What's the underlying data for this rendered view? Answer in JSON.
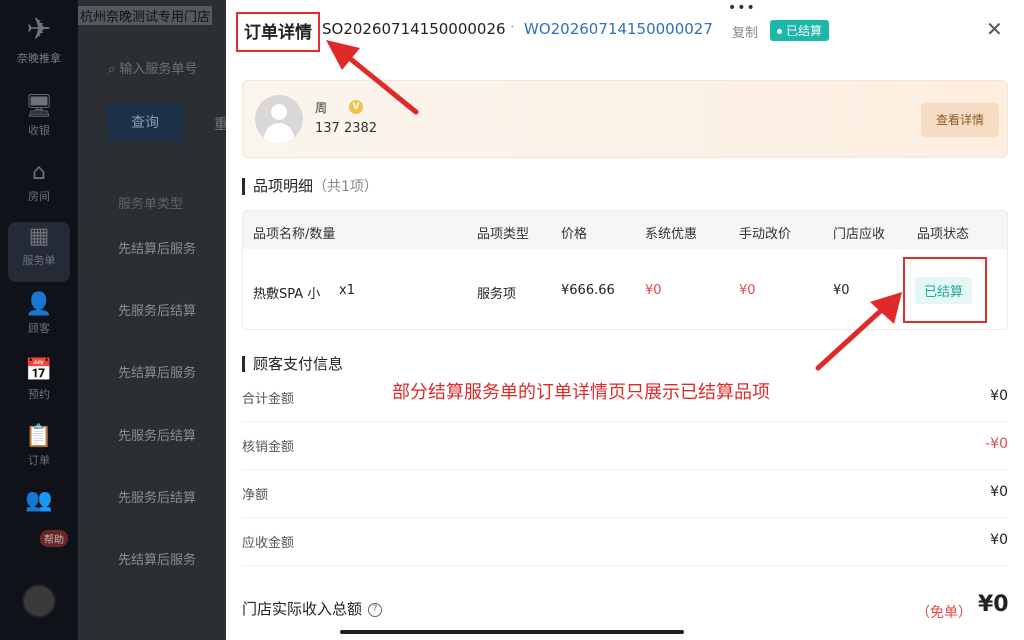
{
  "sidebar": {
    "brand": "奈晚推拿",
    "items": [
      {
        "label": "收银",
        "icon": "cashier-monitor-icon"
      },
      {
        "label": "房间",
        "icon": "room-house-icon"
      },
      {
        "label": "服务单",
        "icon": "service-order-icon"
      },
      {
        "label": "顾客",
        "icon": "customer-person-icon"
      },
      {
        "label": "预约",
        "icon": "appointment-calendar-icon"
      },
      {
        "label": "订单",
        "icon": "order-clipboard-icon"
      },
      {
        "label": "",
        "icon": "staff-group-icon"
      }
    ],
    "help_label": "帮助"
  },
  "background": {
    "store_name": "杭州奈晚测试专用门店",
    "search_placeholder": "输入服务单号",
    "query_button": "查询",
    "reset_button": "重",
    "column_header": "服务单类型",
    "rows": [
      "先结算后服务",
      "先服务后结算",
      "先结算后服务",
      "先服务后结算",
      "先服务后结算",
      "先结算后服务"
    ]
  },
  "panel": {
    "title": "订单详情",
    "so_number": "SO20260714150000026",
    "separator": "·",
    "wo_number": "WO20260714150000027",
    "copy_label": "复制",
    "status": "已结算",
    "close_symbol": "✕",
    "customer": {
      "name": "周",
      "vip_badge": "V",
      "phone": "137    2382",
      "view_button": "查看详情"
    },
    "items_section": {
      "title": "品项明细",
      "count": "（共1项）",
      "headers": [
        "品项名称/数量",
        "品项类型",
        "价格",
        "系统优惠",
        "手动改价",
        "门店应收",
        "品项状态"
      ],
      "rows": [
        {
          "name": "热敷SPA 小",
          "qty": "x1",
          "type": "服务项",
          "price": "¥666.66",
          "system_discount": "¥0",
          "manual_change": "¥0",
          "store_receivable": "¥0",
          "status": "已结算"
        }
      ]
    },
    "payment_section": {
      "title": "顾客支付信息",
      "rows": [
        {
          "label": "合计金额",
          "value": "¥0"
        },
        {
          "label": "核销金额",
          "value": "-¥0"
        },
        {
          "label": "净额",
          "value": "¥0"
        },
        {
          "label": "应收金额",
          "value": "¥0"
        }
      ]
    },
    "total": {
      "label": "门店实际收入总额",
      "help": "?",
      "free_tag": "（免单）",
      "value": "¥0"
    }
  },
  "annotation": {
    "text": "部分结算服务单的订单详情页只展示已结算品项",
    "color": "#e02a2a"
  }
}
